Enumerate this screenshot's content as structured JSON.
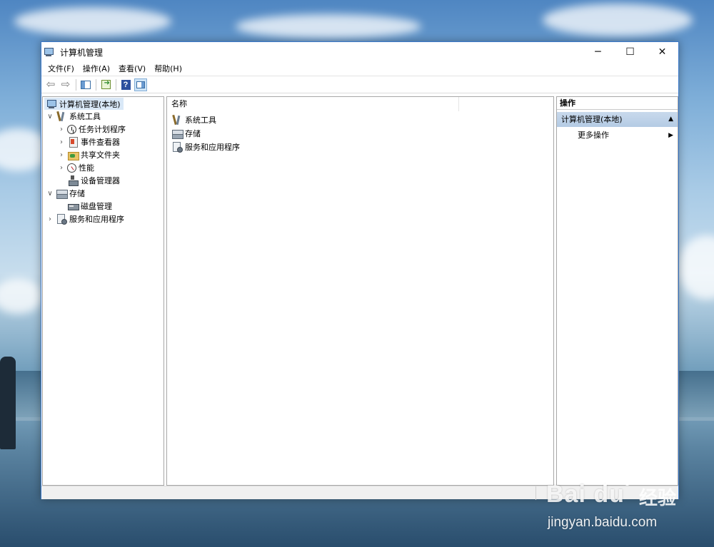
{
  "window": {
    "title": "计算机管理",
    "controls": {
      "minimize": "─",
      "maximize": "☐",
      "close": "✕"
    }
  },
  "menu": [
    "文件(F)",
    "操作(A)",
    "查看(V)",
    "帮助(H)"
  ],
  "toolbar": {
    "back_icon": "⇦",
    "forward_icon": "⇨",
    "help_glyph": "?"
  },
  "tree": {
    "root": {
      "label": "计算机管理(本地)",
      "icon": "computer-icon"
    },
    "system_tools": {
      "label": "系统工具",
      "children": [
        {
          "label": "任务计划程序",
          "icon": "task-scheduler-icon"
        },
        {
          "label": "事件查看器",
          "icon": "event-viewer-icon"
        },
        {
          "label": "共享文件夹",
          "icon": "shared-folders-icon"
        },
        {
          "label": "性能",
          "icon": "performance-icon"
        },
        {
          "label": "设备管理器",
          "icon": "device-manager-icon"
        }
      ]
    },
    "storage": {
      "label": "存储",
      "children": [
        {
          "label": "磁盘管理",
          "icon": "disk-management-icon"
        }
      ]
    },
    "services": {
      "label": "服务和应用程序"
    },
    "expanded_glyph": "∨",
    "collapsed_glyph": "›"
  },
  "center": {
    "column_header": "名称",
    "items": [
      {
        "label": "系统工具",
        "icon": "tools-icon"
      },
      {
        "label": "存储",
        "icon": "storage-icon"
      },
      {
        "label": "服务和应用程序",
        "icon": "services-icon"
      }
    ]
  },
  "actions": {
    "title": "操作",
    "group_label": "计算机管理(本地)",
    "group_glyph": "▲",
    "more_label": "更多操作",
    "more_glyph": "▶"
  },
  "watermark": {
    "logo_text": "Bai du",
    "cn_text": "经验",
    "url": "jingyan.baidu.com"
  },
  "colors": {
    "accent_border": "#3a78c9",
    "selection": "#d9e8f7",
    "action_header": "#b4cbe4"
  }
}
